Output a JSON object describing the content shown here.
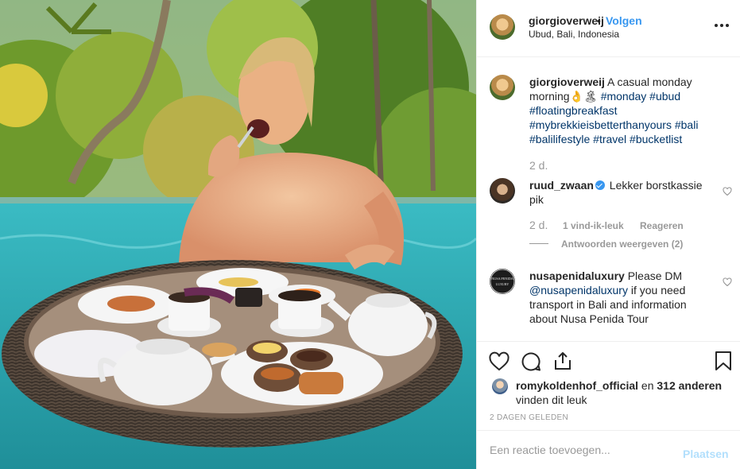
{
  "post": {
    "author": "giorgioverweij",
    "separator": "•",
    "follow_label": "Volgen",
    "location": "Ubud, Bali, Indonesia",
    "more_icon": "more-horizontal-icon"
  },
  "caption": {
    "username": "giorgioverweij",
    "text": "A casual monday morning👌🏝",
    "tags_line1": "#monday #ubud",
    "tags_line2": "#floatingbreakfast",
    "tags_line3": "#mybrekkieisbetterthanyours #bali",
    "tags_line4": "#balilifestyle #travel #bucketlist",
    "age": "2 d."
  },
  "comments": [
    {
      "username": "ruud_zwaan",
      "verified": true,
      "text_part1": "Lekker borstkassie",
      "text_part2": "pik",
      "age": "2 d.",
      "likes": "1 vind-ik-leuk",
      "reply_label": "Reageren",
      "view_replies": "Antwoorden weergeven (2)"
    },
    {
      "username": "nusapenidaluxury",
      "line1": "Please DM",
      "mention": "@nusapenidaluxury",
      "line2": "if you need",
      "line3": "transport in Bali and information",
      "line4": "about Nusa Penida Tour",
      "avatar_text_1": "NUSA PENIDA",
      "avatar_text_2": "LUXURY"
    }
  ],
  "actions": {
    "like_icon": "heart-icon",
    "comment_icon": "comment-icon",
    "share_icon": "share-icon",
    "save_icon": "bookmark-icon"
  },
  "likes": {
    "liker": "romykoldenhof_official",
    "connector": "en",
    "others": "312 anderen",
    "suffix": "vinden dit leuk"
  },
  "timestamp": "2 DAGEN GELEDEN",
  "comment_form": {
    "placeholder": "Een reactie toevoegen...",
    "post_label": "Plaatsen"
  },
  "colors": {
    "link": "#3897f0",
    "hashtag": "#003569",
    "muted": "#999999",
    "post_disabled": "#b2dffc"
  }
}
